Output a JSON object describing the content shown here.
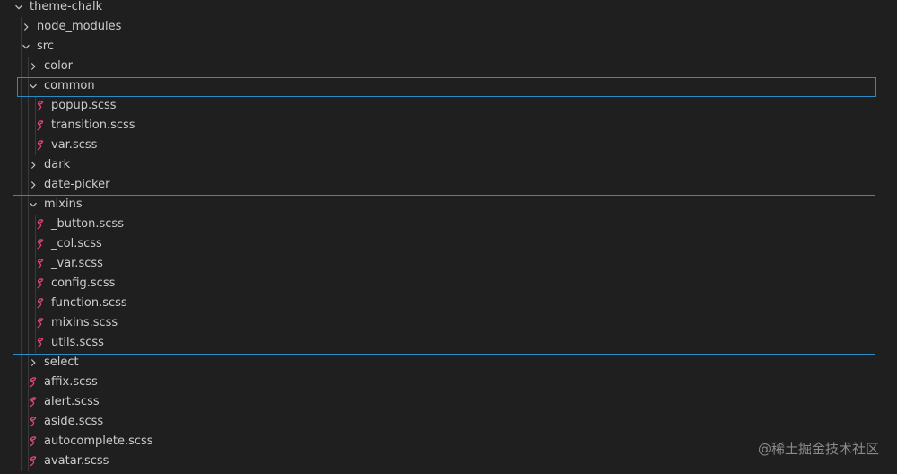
{
  "explorer": {
    "items": [
      {
        "label": "theme-chalk",
        "kind": "folder",
        "expanded": true,
        "depth": 0
      },
      {
        "label": "node_modules",
        "kind": "folder",
        "expanded": false,
        "depth": 1
      },
      {
        "label": "src",
        "kind": "folder",
        "expanded": true,
        "depth": 1
      },
      {
        "label": "color",
        "kind": "folder",
        "expanded": false,
        "depth": 2
      },
      {
        "label": "common",
        "kind": "folder",
        "expanded": true,
        "depth": 2
      },
      {
        "label": "popup.scss",
        "kind": "file",
        "depth": 3
      },
      {
        "label": "transition.scss",
        "kind": "file",
        "depth": 3
      },
      {
        "label": "var.scss",
        "kind": "file",
        "depth": 3
      },
      {
        "label": "dark",
        "kind": "folder",
        "expanded": false,
        "depth": 2
      },
      {
        "label": "date-picker",
        "kind": "folder",
        "expanded": false,
        "depth": 2
      },
      {
        "label": "mixins",
        "kind": "folder",
        "expanded": true,
        "depth": 2
      },
      {
        "label": "_button.scss",
        "kind": "file",
        "depth": 3
      },
      {
        "label": "_col.scss",
        "kind": "file",
        "depth": 3
      },
      {
        "label": "_var.scss",
        "kind": "file",
        "depth": 3
      },
      {
        "label": "config.scss",
        "kind": "file",
        "depth": 3
      },
      {
        "label": "function.scss",
        "kind": "file",
        "depth": 3
      },
      {
        "label": "mixins.scss",
        "kind": "file",
        "depth": 3
      },
      {
        "label": "utils.scss",
        "kind": "file",
        "depth": 3
      },
      {
        "label": "select",
        "kind": "folder",
        "expanded": false,
        "depth": 2
      },
      {
        "label": "affix.scss",
        "kind": "file",
        "depth": 2
      },
      {
        "label": "alert.scss",
        "kind": "file",
        "depth": 2
      },
      {
        "label": "aside.scss",
        "kind": "file",
        "depth": 2
      },
      {
        "label": "autocomplete.scss",
        "kind": "file",
        "depth": 2
      },
      {
        "label": "avatar.scss",
        "kind": "file",
        "depth": 2
      }
    ],
    "highlighted_folders": [
      "common",
      "mixins"
    ],
    "file_icon": "sass-icon",
    "folder_icons": {
      "expanded": "chevron-down-icon",
      "collapsed": "chevron-right-icon"
    }
  },
  "watermark": "@稀土掘金技术社区",
  "colors": {
    "background": "#1f1f1f",
    "text": "#cccccc",
    "sass": "#e0457b",
    "focus_border": "#2b8cc4",
    "indent_guide": "#3a3a3a"
  }
}
